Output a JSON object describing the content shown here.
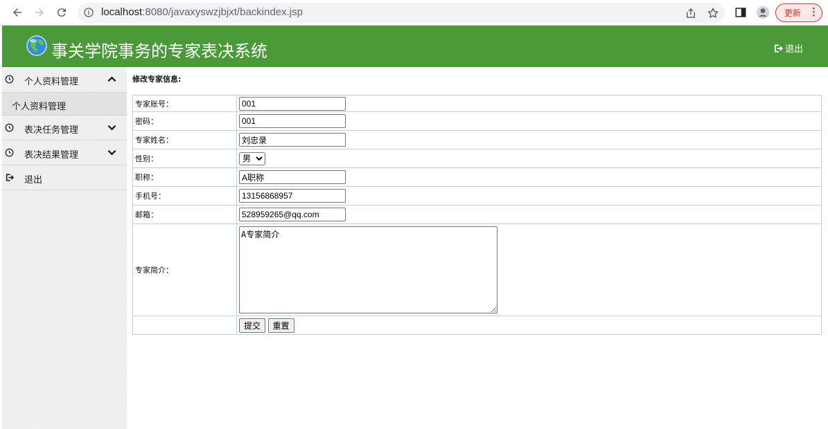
{
  "browser": {
    "url_host": "localhost",
    "url_rest": ":8080/javaxyswzjbjxt/backindex.jsp",
    "update_label": "更新"
  },
  "header": {
    "title": "事关学院事务的专家表决系统",
    "logout_label": "退出"
  },
  "sidebar": {
    "items": [
      {
        "label": "个人资料管理",
        "expanded": true
      },
      {
        "label": "表决任务管理",
        "expanded": false
      },
      {
        "label": "表决结果管理",
        "expanded": false
      },
      {
        "label": "退出"
      }
    ],
    "subitem": "个人资料管理"
  },
  "form": {
    "section_title": "修改专家信息:",
    "account_label": "专家账号：",
    "account_value": "001",
    "password_label": "密码：",
    "password_value": "001",
    "name_label": "专家姓名：",
    "name_value": "刘忠录",
    "gender_label": "性别：",
    "gender_value": "男",
    "title_label": "职称：",
    "title_value": "A职称",
    "phone_label": "手机号：",
    "phone_value": "13156868957",
    "email_label": "邮箱：",
    "email_value": "528959265@qq.com",
    "intro_label": "专家简介：",
    "intro_value": "A专家简介",
    "submit_label": "提交",
    "reset_label": "重置"
  },
  "colors": {
    "header_bg": "#4a9a3a",
    "table_border": "#b6d3e0",
    "update_red": "#d93025"
  }
}
